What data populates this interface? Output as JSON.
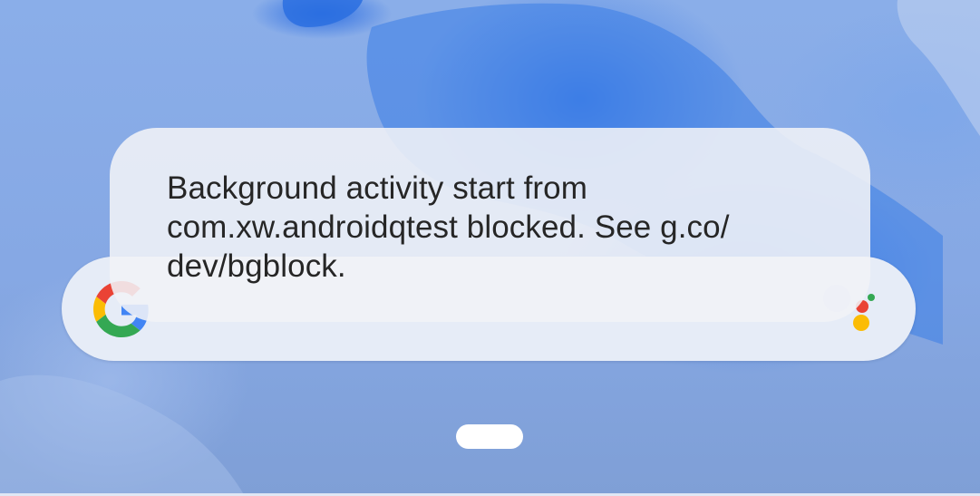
{
  "toast": {
    "message": "Background activity start from com.xw.androidqtest blocked. See g.co/ dev/bgblock."
  },
  "search_widget": {
    "logo_icon": "google-g-icon",
    "assistant_icon": "google-assistant-icon"
  },
  "navigation": {
    "handle_icon": "gesture-handle"
  },
  "colors": {
    "google_blue": "#4285F4",
    "google_red": "#EA4335",
    "google_yellow": "#FBBC05",
    "google_green": "#34A853"
  }
}
